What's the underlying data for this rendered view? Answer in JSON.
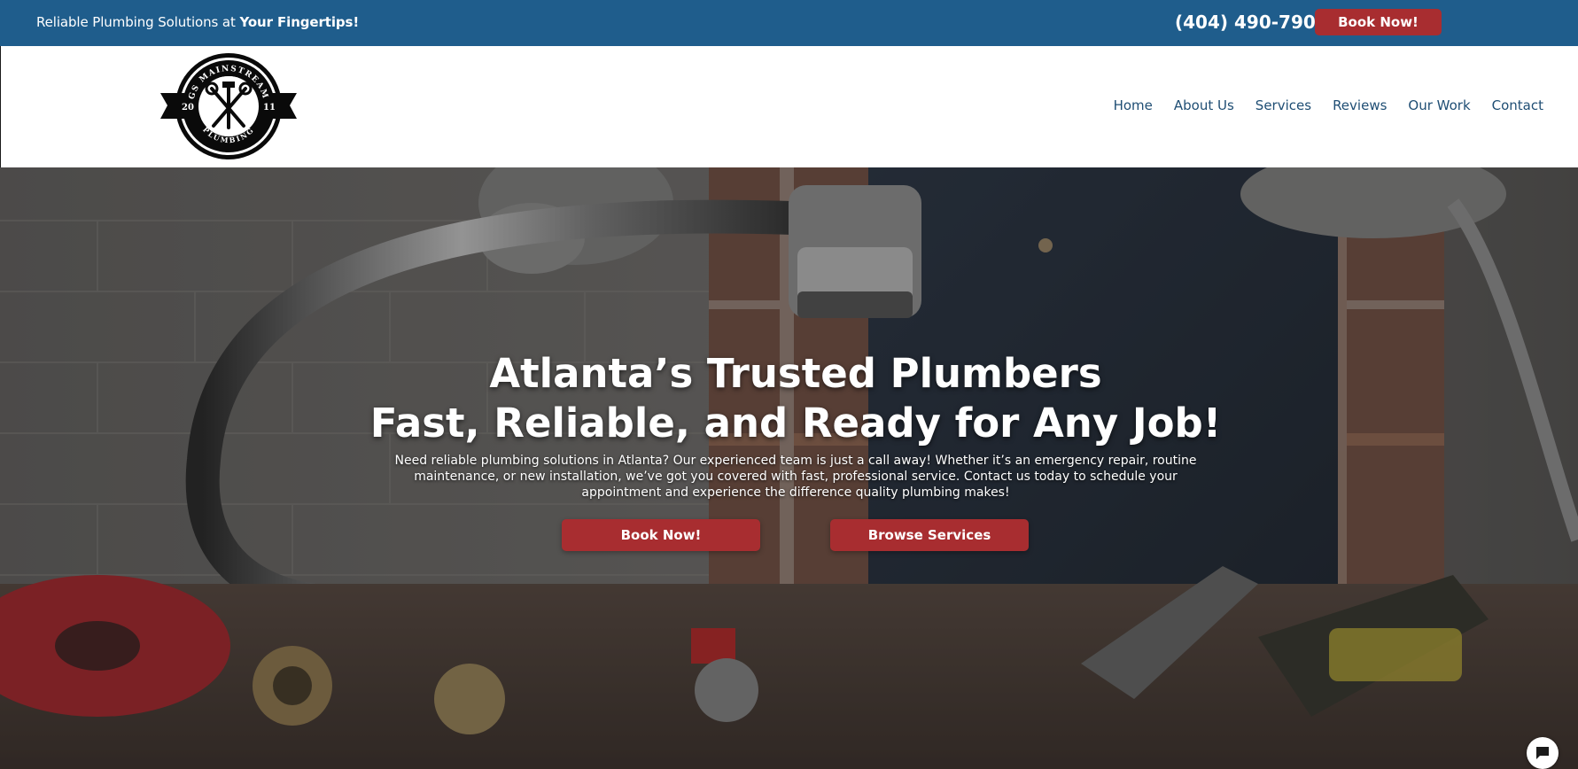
{
  "topbar": {
    "tagline_prefix": "Reliable Plumbing Solutions at ",
    "tagline_bold": "Your Fingertips!",
    "phone": "(404) 490-7901",
    "book_label": "Book Now!"
  },
  "logo": {
    "arc_text": "GS MAINSTREAM",
    "bottom_text": "PLUMBING",
    "year_left": "20",
    "year_right": "11"
  },
  "nav": {
    "items": [
      {
        "label": "Home"
      },
      {
        "label": "About Us"
      },
      {
        "label": "Services"
      },
      {
        "label": "Reviews"
      },
      {
        "label": "Our Work"
      },
      {
        "label": "Contact"
      }
    ]
  },
  "hero": {
    "title_line1": "Atlanta’s Trusted Plumbers",
    "title_line2": "Fast, Reliable, and Ready for Any Job!",
    "description": "Need reliable plumbing solutions in Atlanta? Our experienced team is just a call away! Whether it’s an emergency repair, routine maintenance, or new installation, we’ve got you covered with fast, professional service. Contact us today to schedule your appointment and experience the difference quality plumbing makes!",
    "book_label": "Book Now!",
    "services_label": "Browse Services"
  },
  "colors": {
    "topbar": "#1f5d8c",
    "accent": "#a82d30",
    "nav_text": "#1f4e74"
  },
  "icons": {
    "chat": "chat-bubble-icon",
    "logo": "wrench-logo-icon"
  }
}
